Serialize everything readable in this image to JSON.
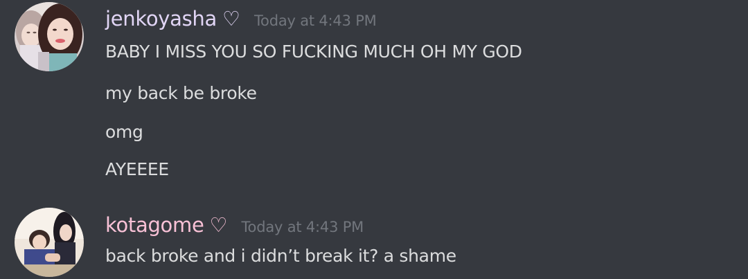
{
  "colors": {
    "background": "#36393f",
    "message_text": "#dcddde",
    "timestamp": "#72767d"
  },
  "messages": [
    {
      "username": "jenkoyasha",
      "username_color": "#e1d5f5",
      "heart_icon": "heart-outline-icon",
      "timestamp": "Today at 4:43 PM",
      "lines": [
        "BABY I MISS YOU SO FUCKING MUCH OH MY GOD",
        "my back be broke",
        "omg",
        "AYEEEE"
      ]
    },
    {
      "username": "kotagome",
      "username_color": "#f8c1d6",
      "heart_icon": "heart-outline-icon",
      "timestamp": "Today at 4:43 PM",
      "lines": [
        "back broke and i didn’t break it? a shame"
      ]
    }
  ]
}
